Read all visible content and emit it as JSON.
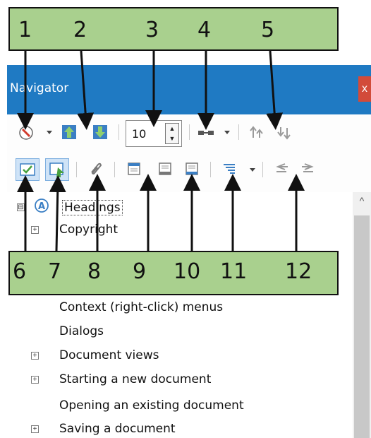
{
  "window": {
    "title": "Navigator",
    "close_label": "x"
  },
  "toolbar": {
    "row1": {
      "navigation_icon": "compass-icon",
      "dropdown_icon": "chevron-down-icon",
      "previous_icon": "arrow-up-box-icon",
      "next_icon": "arrow-down-box-icon",
      "heading_levels_value": "10",
      "drag_mode_icon": "drag-mode-icon",
      "promote_chapter_icon": "promote-chapter-icon",
      "demote_chapter_icon": "demote-chapter-icon"
    },
    "row2": {
      "content_view_icon": "content-view-icon",
      "set_reminder_icon": "set-reminder-icon",
      "header_icon": "header-icon",
      "footer_icon": "footer-icon",
      "anchor_icon": "anchor-icon",
      "heading_level_icon": "heading-levels-icon",
      "promote_level_icon": "promote-level-icon",
      "demote_level_icon": "demote-level-icon"
    }
  },
  "tree": {
    "items": [
      {
        "label": "Headings",
        "expander": "⊟"
      },
      {
        "label": "Copyright",
        "expander": "+"
      },
      {
        "label": "Context (right-click) menus",
        "expander": ""
      },
      {
        "label": "Dialogs",
        "expander": ""
      },
      {
        "label": "Document views",
        "expander": "+"
      },
      {
        "label": "Starting a new document",
        "expander": "+"
      },
      {
        "label": "Opening an existing document",
        "expander": ""
      },
      {
        "label": "Saving a document",
        "expander": "+"
      }
    ]
  },
  "callouts": {
    "top": [
      "1",
      "2",
      "3",
      "4",
      "5"
    ],
    "bottom": [
      "6",
      "7",
      "8",
      "9",
      "10",
      "11",
      "12"
    ]
  },
  "colors": {
    "callout_fill": "#a9d08e",
    "titlebar": "#1f7ac3",
    "close": "#d24b3a"
  }
}
